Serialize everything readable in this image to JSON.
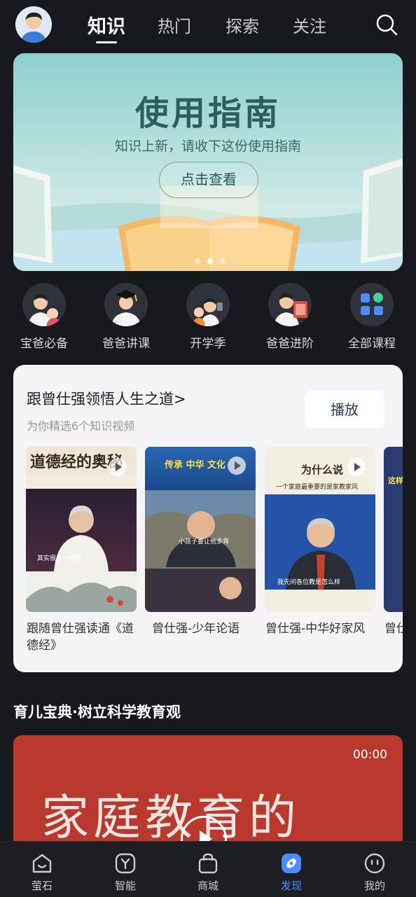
{
  "top_tabs": [
    "知识",
    "热门",
    "探索",
    "关注"
  ],
  "banner": {
    "title": "使用指南",
    "subtitle": "知识上新，请收下这份使用指南",
    "button_label": "点击查看"
  },
  "categories": [
    "宝爸必备",
    "爸爸讲课",
    "开学季",
    "爸爸进阶",
    "全部课程"
  ],
  "course_card": {
    "title": "跟曾仕强领悟人生之道>",
    "subtitle": "为你精选6个知识视频",
    "play_label": "播放",
    "videos": [
      {
        "caption": "跟随曾仕强读通《道德经》",
        "thumb_text": "道德经的奥秘",
        "overlay_text": "其实很多一问题"
      },
      {
        "caption": "曾仕强-少年论语",
        "thumb_text": "传承 中华 文化",
        "overlay_text": "小孩子要让他多背"
      },
      {
        "caption": "曾仕强-中华好家风",
        "thumb_text": "为什么说",
        "thumb_text2": "一个家庭最重要的是家教家风",
        "overlay_text": "我先问各位教是怎么样"
      },
      {
        "caption": "曾仕强讲堂",
        "thumb_text": "这样"
      }
    ]
  },
  "section": {
    "title": "育儿宝典·树立科学教育观",
    "video_time": "00:00",
    "video_text": "家庭教育的"
  },
  "bottom_nav": [
    "萤石",
    "智能",
    "商城",
    "发现",
    "我的"
  ],
  "colors": {
    "accent": "#4d8cff",
    "banner": "#8ecfcf",
    "video_bg": "#b9392f"
  }
}
